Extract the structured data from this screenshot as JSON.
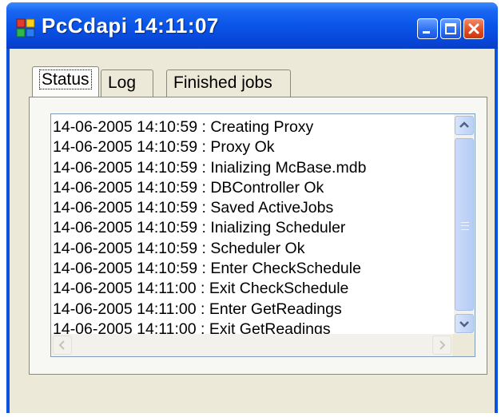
{
  "window": {
    "title": "PcCdapi  14:11:07",
    "controls": {
      "minimize": "minimize",
      "maximize": "maximize",
      "close": "close"
    }
  },
  "tabs": [
    {
      "label": "Status",
      "active": true
    },
    {
      "label": "Log",
      "active": false
    },
    {
      "label": "Finished jobs",
      "active": false
    }
  ],
  "log": {
    "lines": [
      "14-06-2005 14:10:59 : Creating Proxy",
      "14-06-2005 14:10:59 : Proxy Ok",
      "14-06-2005 14:10:59 : Inializing McBase.mdb",
      "14-06-2005 14:10:59 : DBController Ok",
      "14-06-2005 14:10:59 : Saved ActiveJobs",
      "14-06-2005 14:10:59 : Inializing Scheduler",
      "14-06-2005 14:10:59 : Scheduler Ok",
      "14-06-2005 14:10:59 : Enter CheckSchedule",
      "14-06-2005 14:11:00 : Exit CheckSchedule",
      "14-06-2005 14:11:00 : Enter GetReadings",
      "14-06-2005 14:11:00 : Exit GetReadings"
    ]
  },
  "icons": {
    "app": "app-grid-icon",
    "scroll_up": "chevron-up-icon",
    "scroll_down": "chevron-down-icon",
    "scroll_left": "chevron-left-icon",
    "scroll_right": "chevron-right-icon"
  },
  "colors": {
    "titlebar": "#0a55e8",
    "client_bg": "#ece9d8",
    "close_button": "#e04a1e"
  }
}
